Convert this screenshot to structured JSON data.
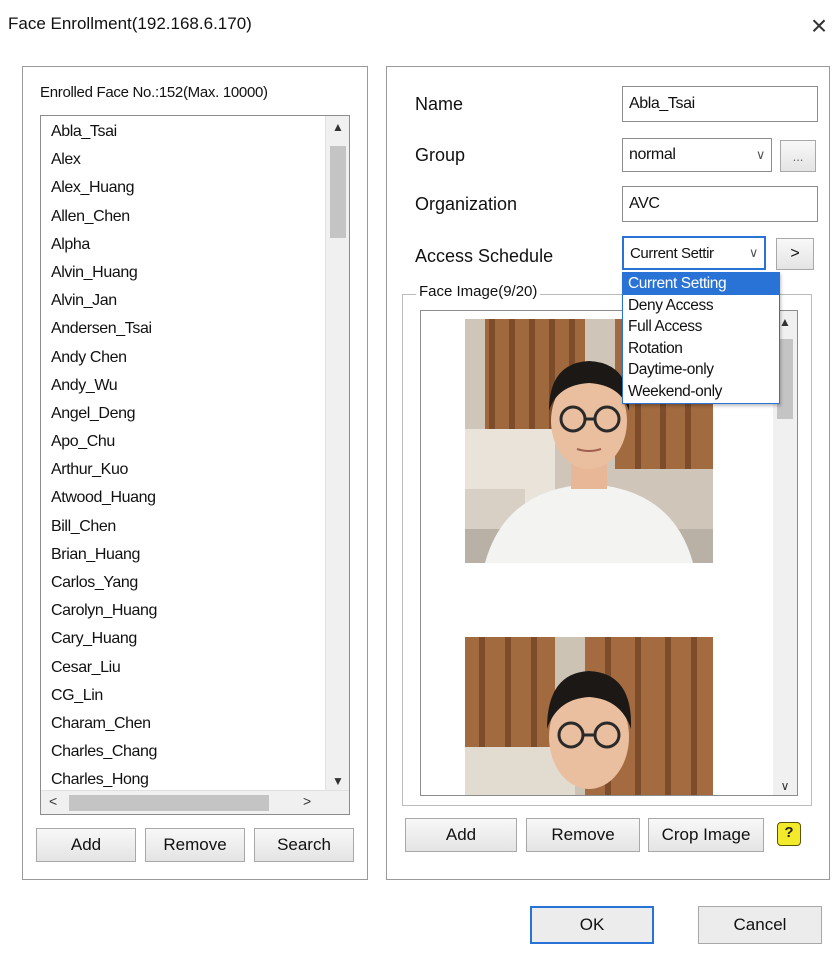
{
  "window": {
    "title": "Face Enrollment(192.168.6.170)",
    "close_glyph": "×"
  },
  "left": {
    "enrolled_label": "Enrolled Face No.:152(Max. 10000)",
    "items": [
      "Abla_Tsai",
      "Alex",
      "Alex_Huang",
      "Allen_Chen",
      "Alpha",
      "Alvin_Huang",
      "Alvin_Jan",
      "Andersen_Tsai",
      "Andy Chen",
      "Andy_Wu",
      "Angel_Deng",
      "Apo_Chu",
      "Arthur_Kuo",
      "Atwood_Huang",
      "Bill_Chen",
      "Brian_Huang",
      "Carlos_Yang",
      "Carolyn_Huang",
      "Cary_Huang",
      "Cesar_Liu",
      "CG_Lin",
      "Charam_Chen",
      "Charles_Chang",
      "Charles_Hong"
    ],
    "buttons": {
      "add": "Add",
      "remove": "Remove",
      "search": "Search"
    }
  },
  "right": {
    "labels": {
      "name": "Name",
      "group": "Group",
      "organization": "Organization",
      "access_schedule": "Access Schedule"
    },
    "name_value": "Abla_Tsai",
    "group_value": "normal",
    "group_more": "...",
    "organization_value": "AVC",
    "access_schedule_value": "Current Settir",
    "schedule_next": ">",
    "schedule_options": [
      "Current Setting",
      "Deny Access",
      "Full Access",
      "Rotation",
      "Daytime-only",
      "Weekend-only"
    ],
    "face_image_label": "Face Image(9/20)",
    "buttons": {
      "add": "Add",
      "remove": "Remove",
      "crop": "Crop Image",
      "help": "?"
    }
  },
  "footer": {
    "ok": "OK",
    "cancel": "Cancel"
  },
  "colors": {
    "accent": "#2a73d6",
    "help_icon": "#f2ea2b"
  }
}
